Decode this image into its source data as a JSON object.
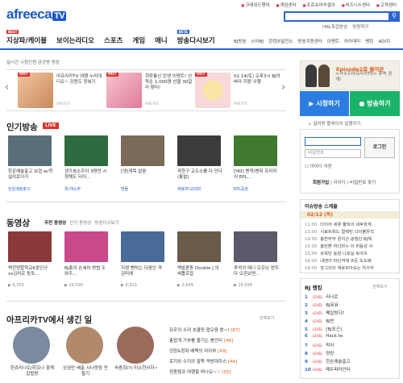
{
  "header": {
    "logo_main": "afreeca",
    "logo_tv": "TV",
    "top_links": [
      "크래쉬드햇어",
      "게임센터",
      "프로슈어커셜어",
      "비즈니스센터",
      "고객센터"
    ],
    "hot_keywords": [
      "HBL특집방송",
      "맞팡학구"
    ]
  },
  "nav": {
    "items": [
      {
        "label": "지상파/케이블",
        "badge": "BEST"
      },
      {
        "label": "보이는라디오",
        "badge": ""
      },
      {
        "label": "스포츠",
        "badge": ""
      },
      {
        "label": "게임",
        "badge": ""
      },
      {
        "label": "애니",
        "badge": ""
      },
      {
        "label": "방송다시보기",
        "badge": "BETA"
      }
    ],
    "sub_items": [
      "BJ방송",
      "스타BJ",
      "콘텐츠발전소",
      "방송지원센터",
      "이벤트",
      "아카데미",
      "뱅킹",
      "ADI지"
    ]
  },
  "notice": "실시간 시청인원 금강방 방송",
  "banners": [
    {
      "hot": "HOT",
      "text": "아프리카TV 여행 누리대디오~ 강원도 정복기",
      "more": "바로가기",
      "color": "#f2c4a0"
    },
    {
      "hot": "HOT",
      "text": "희망통신 탄생 이벤트! 선착순 1,000명 선물 30일리 팬티!",
      "more": "바로가기",
      "color": "#f4c5cf"
    },
    {
      "hot": "HOT",
      "text": "02.14(토) 오후3시 BJ아바타 지원 수행",
      "more": "바로가기",
      "color": "#f7d9d9"
    }
  ],
  "live": {
    "title": "인기방송",
    "badge": "LIVE",
    "items": [
      {
        "title": "한운예술출고 보겹 w/첫실외로이가",
        "meta": "한운예술출고",
        "color": "#5a6e7a"
      },
      {
        "title": "생가복소주이 3편만 시청해도 티어...",
        "meta": "위/개소주",
        "color": "#2f6b3f"
      },
      {
        "title": "[생]게목 없음",
        "meta": "맨돌",
        "color": "#7a6a5a"
      },
      {
        "title": "곽한구 교도소를 다 단다 (통발)",
        "meta": "예봉부/교대회",
        "color": "#3b3b3b"
      },
      {
        "title": "[HD] 첸퀴/첸피 프리미어 EPL...",
        "meta": "EPL등장",
        "color": "#3f7a2f"
      }
    ]
  },
  "vod": {
    "title": "동영상",
    "tabs": [
      "추천 동영상",
      "인기 동영상",
      "방송다시보기"
    ],
    "items": [
      {
        "title": "역전연합학교K중인규 vs김치로 동포...",
        "meta": "6,303",
        "color": "#8a3a3a"
      },
      {
        "title": "BJ총의 손세차 방법 도와주...",
        "meta": "29,599",
        "color": "#c94a8a"
      },
      {
        "title": "지생 뺀치는 다음인 격 김미에",
        "meta": "6,929",
        "color": "#4a6a9a"
      },
      {
        "title": "백발론동 Double J 의 써틀로잡",
        "meta": "2,649",
        "color": "#6a5a4a"
      },
      {
        "title": "추억의 애니 오프닝 연주다 오픈보면...",
        "meta": "16,568",
        "color": "#5a5a6a"
      }
    ]
  },
  "stories": {
    "title": "아프리카TV에서 생긴 일",
    "more": "전체보기",
    "circles": [
      {
        "caption": "한쥬리나오/하프나 함께 잡밥방",
        "color": "#7a8aa0"
      },
      {
        "caption": "상금만 배출 시나랑링 만들기",
        "color": "#b08a6a"
      },
      {
        "caption": "숙즘희(?) 미소천사하~",
        "color": "#9a6a5a"
      }
    ],
    "list": [
      {
        "text": "유우의 수려 초콜릿 팝오음 뿐~!",
        "num": "[87]"
      },
      {
        "text": "총접게 기부를 즐기는 봉인터",
        "num": "[48]"
      },
      {
        "text": "엉청&청화 배팩의 라이부",
        "num": "[49]"
      },
      {
        "text": "로지와 수지의 말뚝 먹방대주스",
        "num": "[44]"
      },
      {
        "text": "정종렴과 여행을 떠나요~♡",
        "num": "[55]"
      }
    ]
  },
  "right": {
    "promo_title": "Episode2로 돌아온",
    "promo_sub": "<거수즈아프리카TV> 후속 공개!",
    "watch_btn": "시청하기",
    "broadcast_btn": "방송하기",
    "install": "설치방 플레이어 실행하기",
    "pw_placeholder": "비밀번호",
    "login_btn": "로그인",
    "save_id": "아이디 저장",
    "join": "회원가입",
    "find": "아이디 / 비밀번호 찾기",
    "schedule_title": "이슈방송 스케줄",
    "schedule_date": "02/12 (목)",
    "schedule": [
      {
        "time": "11:00",
        "text": "다이어 세류 풀피의 세후학계"
      },
      {
        "time": "13:00",
        "text": "시료트워드 컬렉틴 다이불뮤직"
      },
      {
        "time": "14:00",
        "text": "봉찬하닥 꿍치곤 광청인 BJ해"
      },
      {
        "time": "15:30",
        "text": "올빈쁜 하디마누 아 최동성 사"
      },
      {
        "time": "15:00",
        "text": "슈워빈 동원 나포닐 토아츠"
      },
      {
        "time": "16:00",
        "text": "내엔의 파인겨채 프든 도도배"
      },
      {
        "time": "18:00",
        "text": "깡그리의 게로르아요는 자가자"
      }
    ],
    "rank_title": "BJ 랭킹",
    "rank_more": "전체보기",
    "ranking": [
      "러너로",
      "BJ뮤뮤",
      "퀘일빙다?",
      "BJ빈",
      "[BJ포근]",
      "Hack:te",
      "막어",
      "양렁",
      "한손예술출고",
      "메두파마인터"
    ]
  }
}
